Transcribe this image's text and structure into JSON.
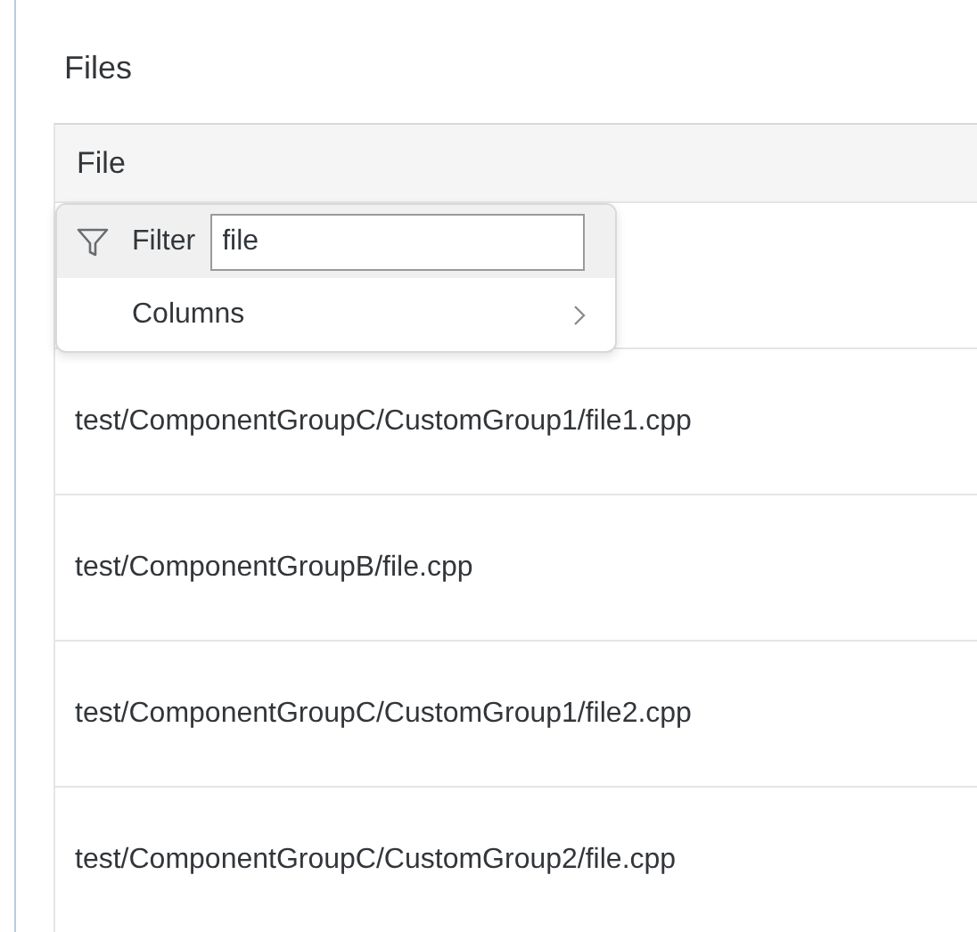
{
  "title": "Files",
  "table": {
    "columns": [
      "File"
    ],
    "rows": [
      {
        "file": "test/ComponentGroupC/CustomGroup1/file1.cpp"
      },
      {
        "file": "test/ComponentGroupB/file.cpp"
      },
      {
        "file": "test/ComponentGroupC/CustomGroup1/file2.cpp"
      },
      {
        "file": "test/ComponentGroupC/CustomGroup2/file.cpp"
      }
    ]
  },
  "menu": {
    "items": [
      {
        "kind": "filter",
        "label": "Filter",
        "value": "file",
        "selected": true
      },
      {
        "kind": "submenu",
        "label": "Columns",
        "selected": false
      }
    ]
  }
}
